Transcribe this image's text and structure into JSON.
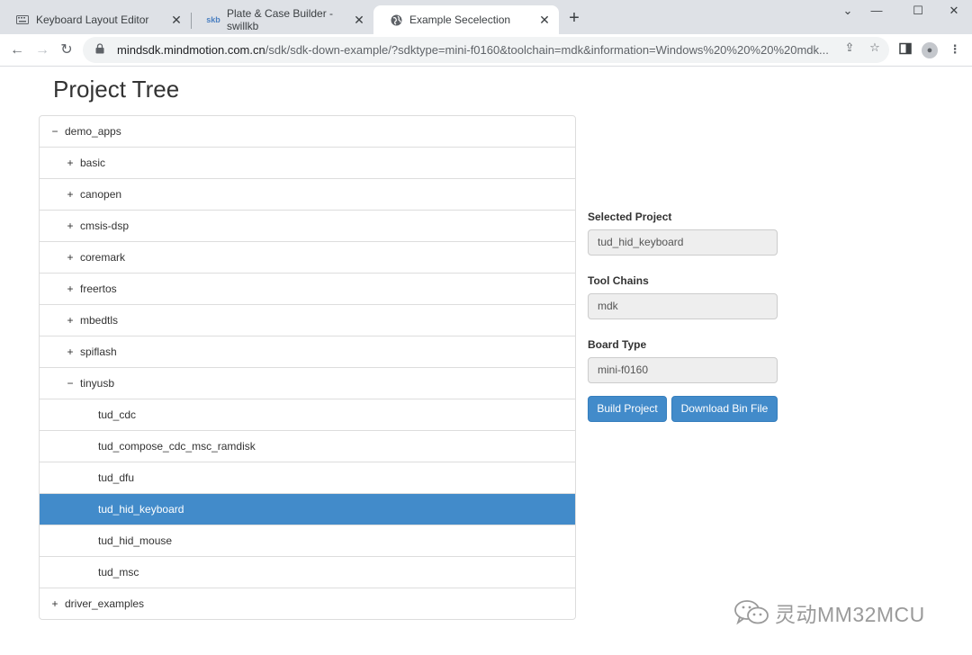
{
  "browser": {
    "tabs": [
      {
        "title": "Keyboard Layout Editor",
        "icon": "keyboard-icon"
      },
      {
        "title": "Plate & Case Builder - swillkb",
        "icon": "swillkb-icon"
      },
      {
        "title": "Example Secelection",
        "icon": "globe-icon",
        "active": true
      }
    ],
    "url_host": "mindsdk.mindmotion.com.cn",
    "url_path": "/sdk/sdk-down-example/?sdktype=mini-f0160&toolchain=mdk&information=Windows%20%20%20%20mdk..."
  },
  "page": {
    "title": "Project Tree"
  },
  "tree": [
    {
      "label": "demo_apps",
      "toggle": "−"
    },
    {
      "label": "basic",
      "toggle": "+"
    },
    {
      "label": "canopen",
      "toggle": "+"
    },
    {
      "label": "cmsis-dsp",
      "toggle": "+"
    },
    {
      "label": "coremark",
      "toggle": "+"
    },
    {
      "label": "freertos",
      "toggle": "+"
    },
    {
      "label": "mbedtls",
      "toggle": "+"
    },
    {
      "label": "spiflash",
      "toggle": "+"
    },
    {
      "label": "tinyusb",
      "toggle": "−"
    },
    {
      "label": "tud_cdc"
    },
    {
      "label": "tud_compose_cdc_msc_ramdisk"
    },
    {
      "label": "tud_dfu"
    },
    {
      "label": "tud_hid_keyboard",
      "selected": true
    },
    {
      "label": "tud_hid_mouse"
    },
    {
      "label": "tud_msc"
    },
    {
      "label": "driver_examples",
      "toggle": "+"
    }
  ],
  "form": {
    "selected_project_label": "Selected Project",
    "selected_project_value": "tud_hid_keyboard",
    "toolchain_label": "Tool Chains",
    "toolchain_value": "mdk",
    "board_label": "Board Type",
    "board_value": "mini-f0160",
    "build_button": "Build Project",
    "download_button": "Download Bin File"
  },
  "watermark": {
    "text": "灵动MM32MCU"
  },
  "colors": {
    "accent": "#428bca",
    "tabbar": "#dee1e6"
  }
}
